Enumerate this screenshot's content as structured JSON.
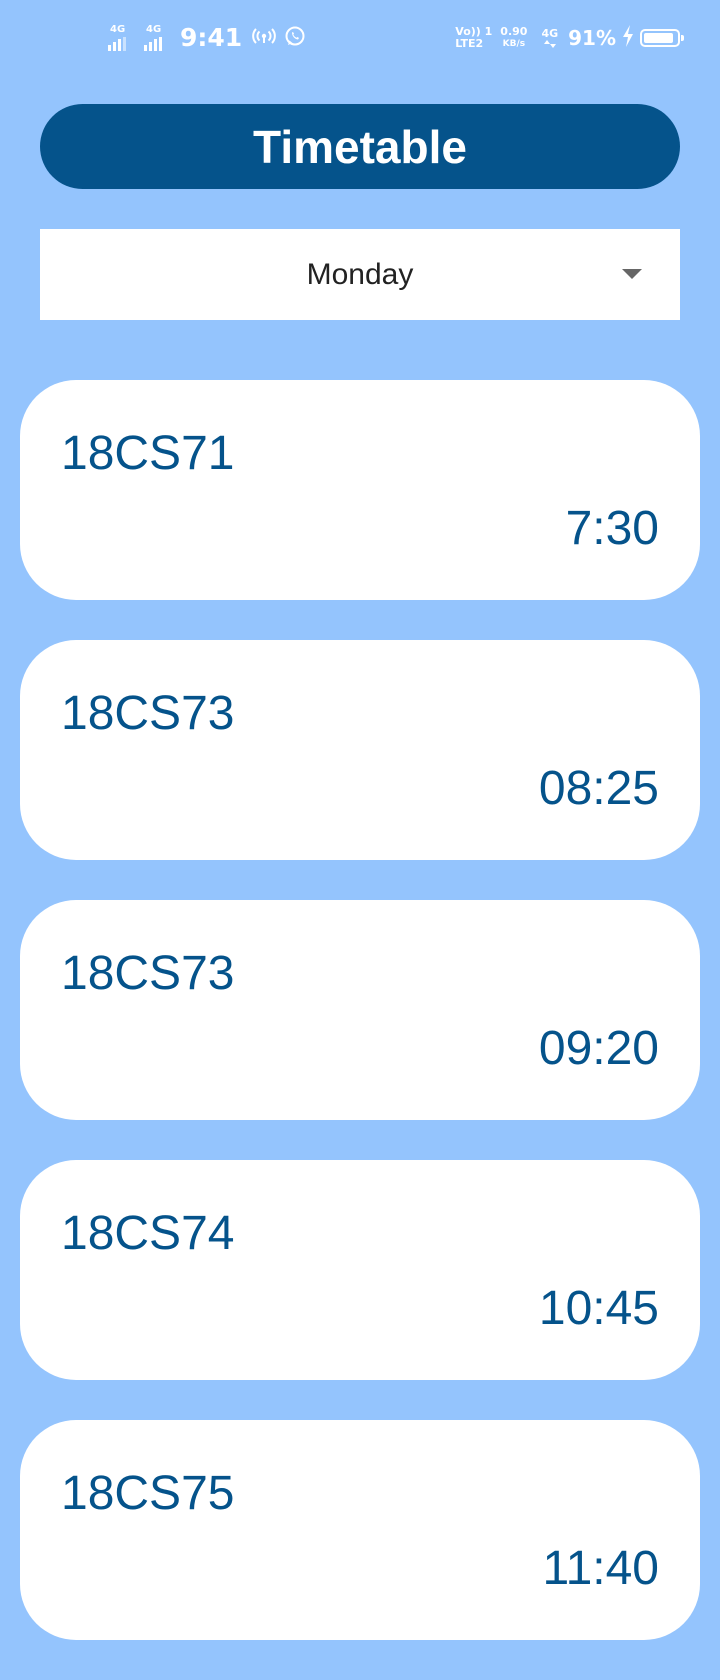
{
  "status_bar": {
    "sim1_network": "4G",
    "sim2_network": "4G",
    "time": "9:41",
    "hotspot_icon": "hotspot-icon",
    "whatsapp_icon": "whatsapp-icon",
    "volte_top": "Vo)) 1",
    "volte_bottom": "LTE2",
    "speed_value": "0.90",
    "speed_unit": "KB/s",
    "data_network": "4G",
    "battery_percent": "91%",
    "battery_level": 0.91,
    "charging_icon": "charging-bolt-icon"
  },
  "header": {
    "title": "Timetable"
  },
  "day_select": {
    "selected": "Monday"
  },
  "classes": [
    {
      "code": "18CS71",
      "time": "7:30"
    },
    {
      "code": "18CS73",
      "time": "08:25"
    },
    {
      "code": "18CS73",
      "time": "09:20"
    },
    {
      "code": "18CS74",
      "time": "10:45"
    },
    {
      "code": "18CS75",
      "time": "11:40"
    }
  ],
  "colors": {
    "background": "#94c4fd",
    "accent": "#05538b",
    "card": "#ffffff"
  }
}
